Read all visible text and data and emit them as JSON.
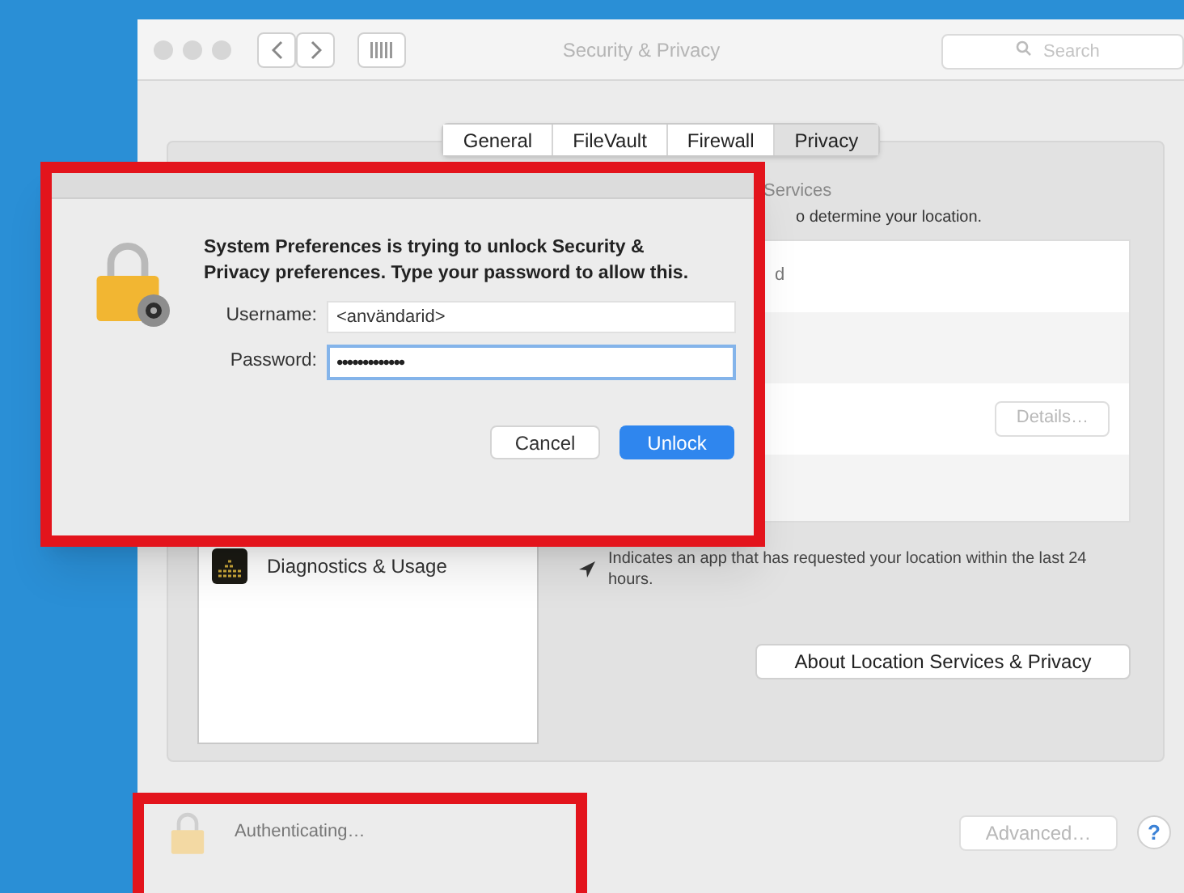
{
  "window": {
    "title": "Security & Privacy",
    "search": {
      "placeholder": "Search"
    }
  },
  "tabs": [
    {
      "label": "General",
      "selected": false
    },
    {
      "label": "FileVault",
      "selected": false
    },
    {
      "label": "Firewall",
      "selected": false
    },
    {
      "label": "Privacy",
      "selected": true
    }
  ],
  "privacy_list": [
    {
      "name": "Diagnostics & Usage",
      "selected": false
    }
  ],
  "location_services": {
    "title": "Services",
    "description": "o determine your location.",
    "apps": [
      {
        "name": "d"
      }
    ],
    "details_button": {
      "label": "Details…",
      "disabled": true
    },
    "note": "Indicates an app that has requested your location within the last 24 hours.",
    "about_button": "About Location Services & Privacy"
  },
  "footer": {
    "status": "Authenticating…",
    "advanced_button": {
      "label": "Advanced…",
      "disabled": true
    },
    "help": "?"
  },
  "dialog": {
    "message": "System Preferences is trying to unlock Security & Privacy preferences. Type your password to allow this.",
    "username_label": "Username:",
    "username": "<användarid>",
    "password_label": "Password:",
    "password": "•••••••••••••",
    "buttons": [
      {
        "label": "Cancel",
        "kind": "default"
      },
      {
        "label": "Unlock",
        "kind": "primary"
      }
    ]
  }
}
